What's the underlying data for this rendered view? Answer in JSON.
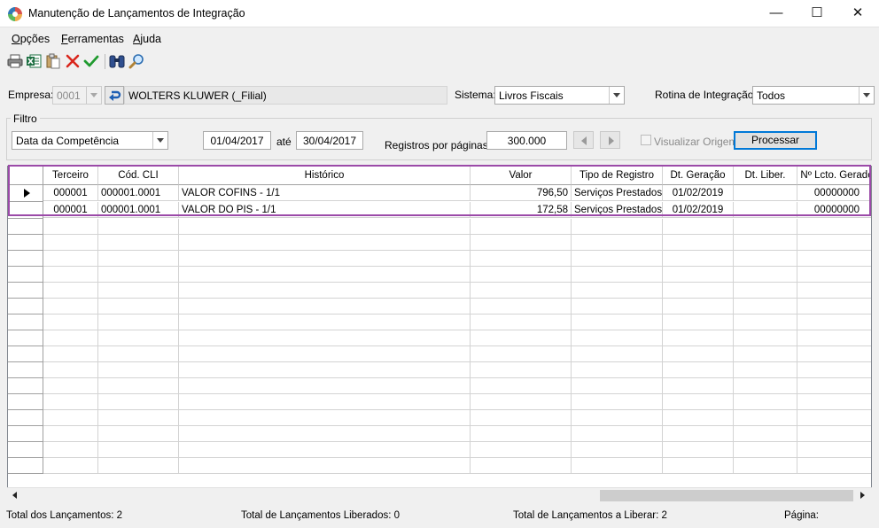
{
  "window": {
    "title": "Manutenção de Lançamentos de Integração",
    "minimize": "—",
    "maximize": "☐",
    "close": "✕"
  },
  "menu": [
    "Opções",
    "Ferramentas",
    "Ajuda"
  ],
  "toolbar": [
    "print-icon",
    "excel-icon",
    "paste-icon",
    "cancel-icon",
    "confirm-icon",
    "binoculars-icon",
    "search-icon"
  ],
  "filters": {
    "empresa_label": "Empresa:",
    "empresa_code": "0001",
    "empresa_name": "WOLTERS KLUWER (_Filial)",
    "sistema_label": "Sistema:",
    "sistema_value": "Livros Fiscais",
    "rotina_label": "Rotina de Integração:",
    "rotina_value": "Todos",
    "filtro_legend": "Filtro",
    "filtro_type": "Data da Competência",
    "date_from": "01/04/2017",
    "ate_label": "até",
    "date_to": "30/04/2017",
    "registros_label": "Registros por páginas:",
    "registros_value": "300.000",
    "visualizar_label": "Visualizar Origem",
    "processar_label": "Processar"
  },
  "grid": {
    "columns": [
      "Terceiro",
      "Cód. CLI",
      "Histórico",
      "Valor",
      "Tipo de Registro",
      "Dt. Geração",
      "Dt. Liber.",
      "Nº Lcto. Gerado"
    ],
    "rows": [
      {
        "terceiro": "000001",
        "cod_cli": "000001.0001",
        "historico": "VALOR COFINS - 1/1",
        "valor": "796,50",
        "tipo": "Serviços Prestados",
        "dt_geracao": "01/02/2019",
        "dt_liber": "",
        "lcto": "00000000"
      },
      {
        "terceiro": "000001",
        "cod_cli": "000001.0001",
        "historico": "VALOR DO PIS - 1/1",
        "valor": "172,58",
        "tipo": "Serviços Prestados",
        "dt_geracao": "01/02/2019",
        "dt_liber": "",
        "lcto": "00000000"
      }
    ]
  },
  "status": {
    "total": "Total dos Lançamentos: 2",
    "liberados": "Total de Lançamentos Liberados: 0",
    "a_liberar": "Total de Lançamentos a Liberar: 2",
    "pagina": "Página:"
  },
  "colors": {
    "highlight": "#9b4aa8",
    "selection": "#0078d7"
  }
}
